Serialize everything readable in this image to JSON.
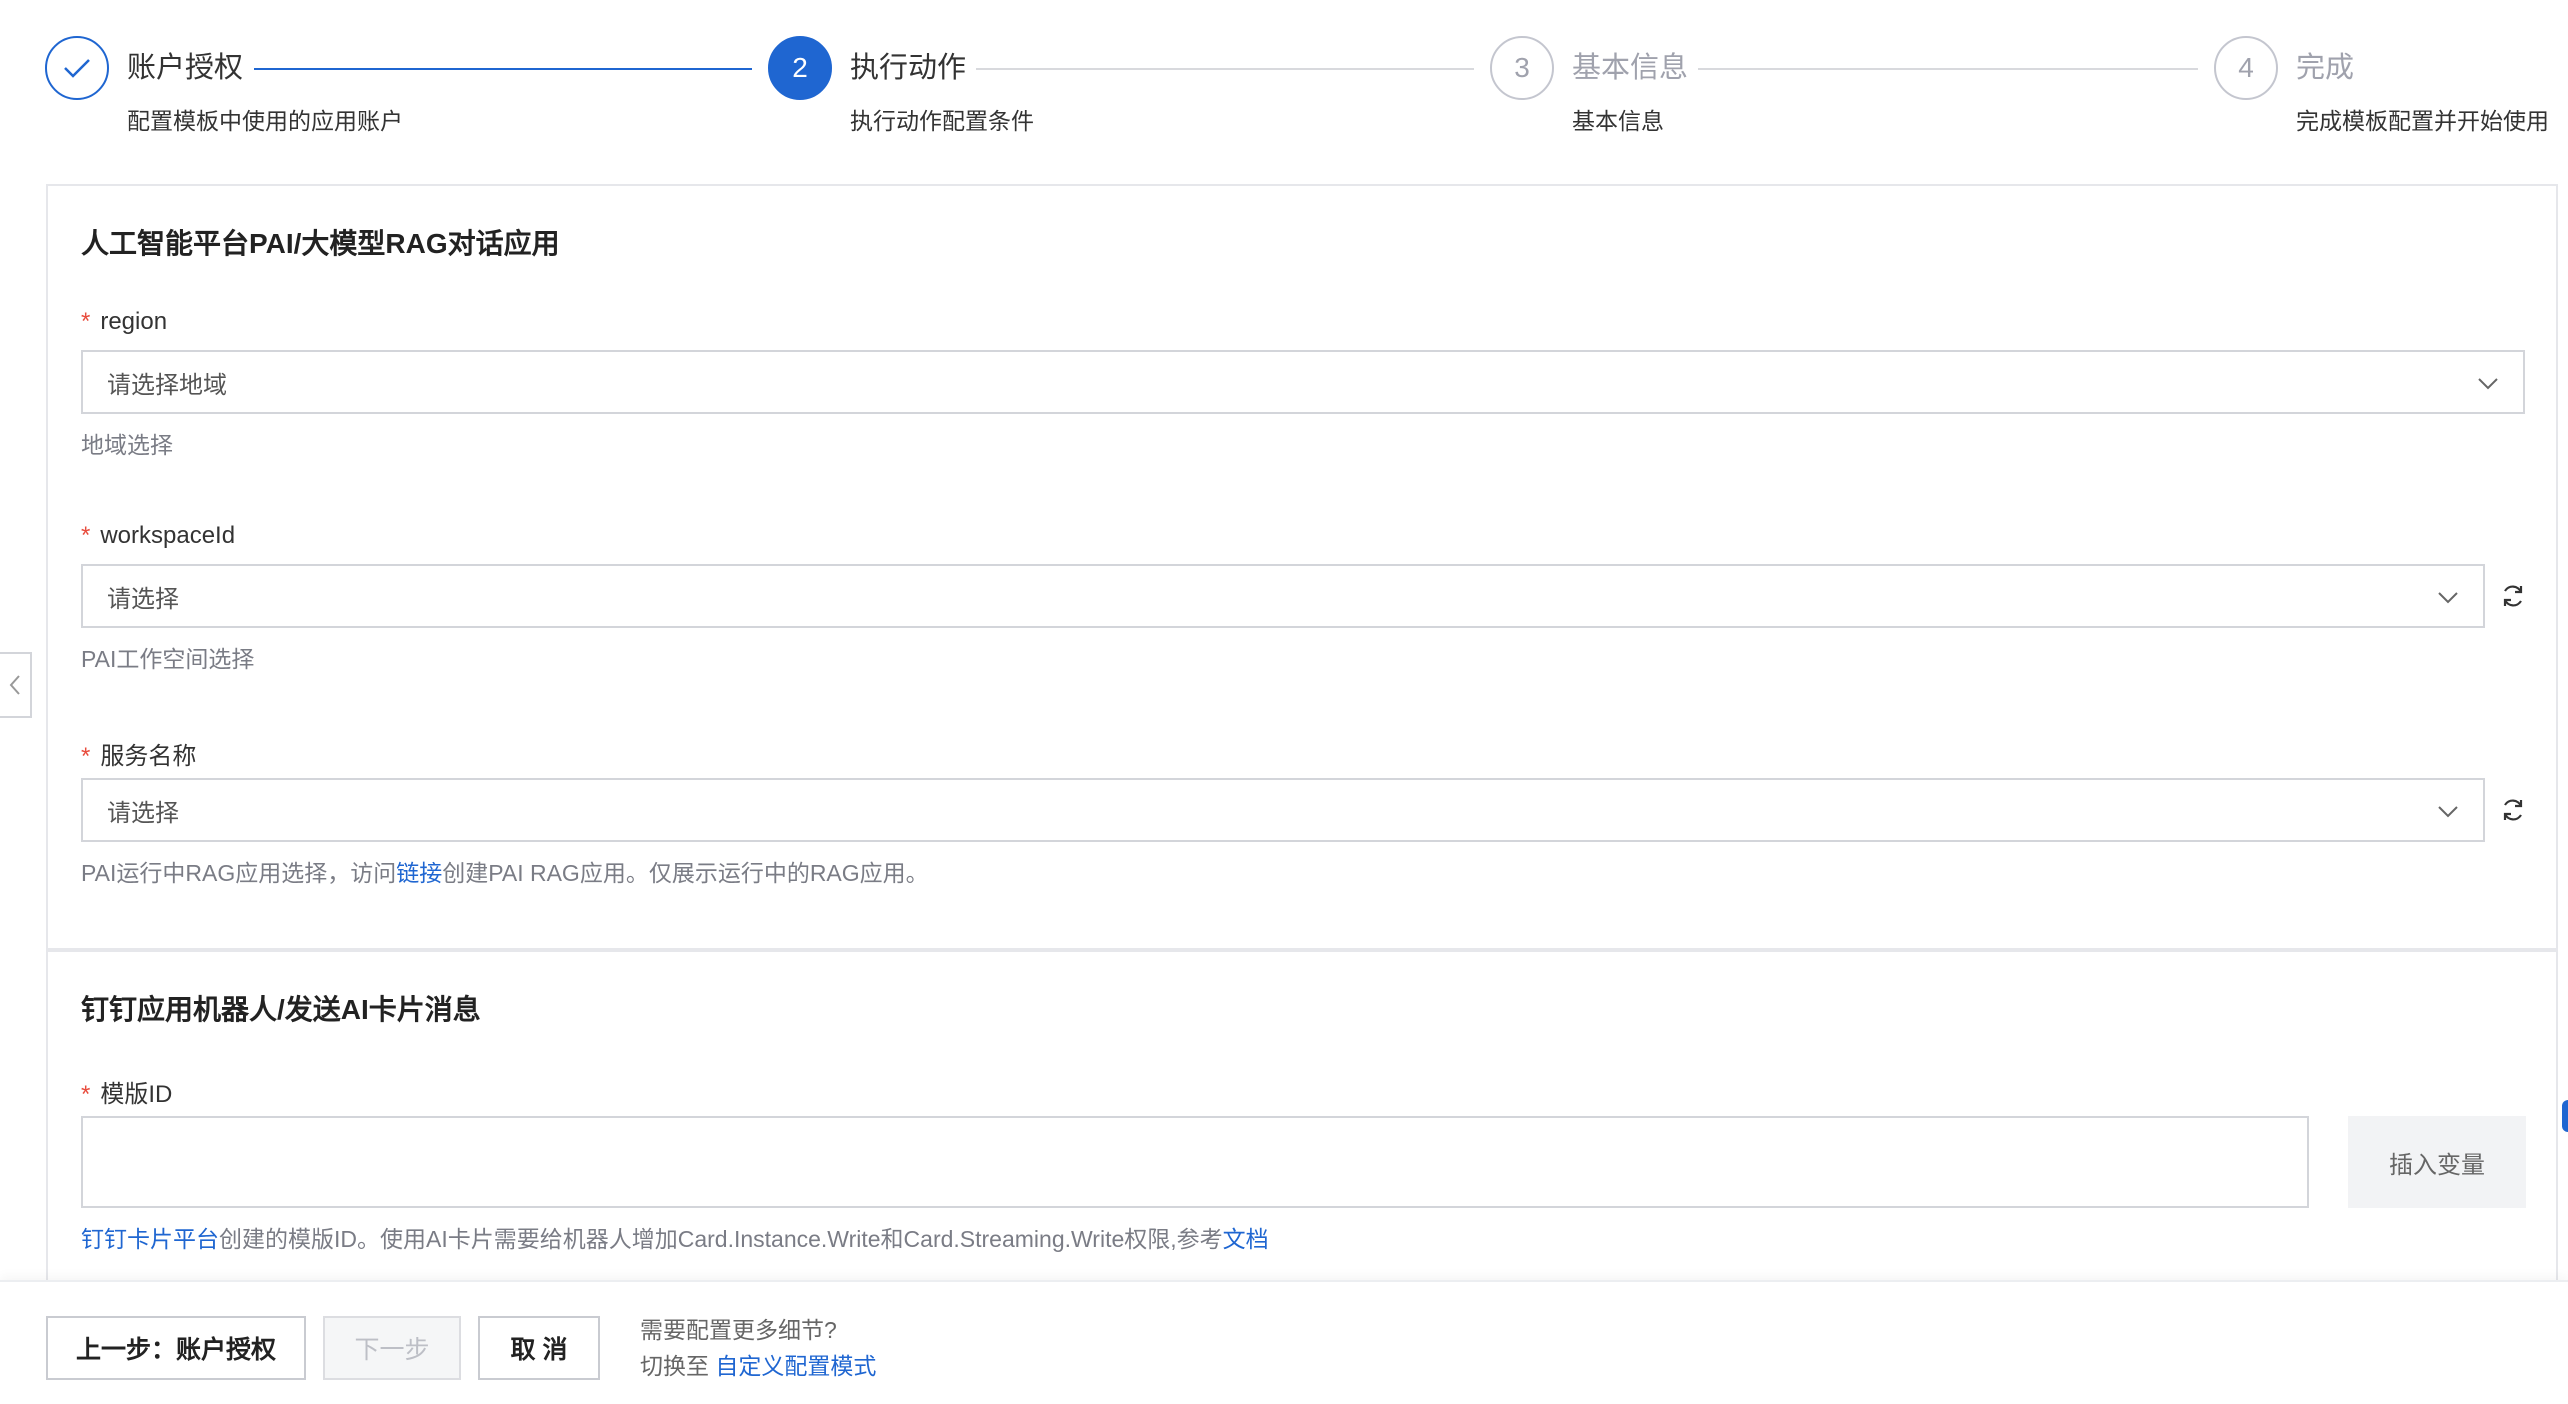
{
  "steps": [
    {
      "number": "1",
      "title": "账户授权",
      "desc": "配置模板中使用的应用账户",
      "state": "done"
    },
    {
      "number": "2",
      "title": "执行动作",
      "desc": "执行动作配置条件",
      "state": "active"
    },
    {
      "number": "3",
      "title": "基本信息",
      "desc": "基本信息",
      "state": "pending"
    },
    {
      "number": "4",
      "title": "完成",
      "desc": "完成模板配置并开始使用",
      "state": "pending"
    }
  ],
  "section1": {
    "title": "人工智能平台PAI/大模型RAG对话应用",
    "region": {
      "label": "region",
      "placeholder": "请选择地域",
      "help": "地域选择"
    },
    "workspace": {
      "label": "workspaceId",
      "placeholder": "请选择",
      "help": "PAI工作空间选择"
    },
    "service": {
      "label": "服务名称",
      "placeholder": "请选择",
      "help_before": "PAI运行中RAG应用选择，访问",
      "help_link": "链接",
      "help_after": "创建PAI RAG应用。仅展示运行中的RAG应用。"
    }
  },
  "section2": {
    "title": "钉钉应用机器人/发送AI卡片消息",
    "template": {
      "label": "模版ID",
      "insert_button": "插入变量",
      "help_link1": "钉钉卡片平台",
      "help_mid": "创建的模版ID。使用AI卡片需要给机器人增加Card.Instance.Write和Card.Streaming.Write权限,参考",
      "help_link2": "文档"
    }
  },
  "required_mark": "*",
  "footer": {
    "prev_button": "上一步：账户授权",
    "next_button": "下一步",
    "cancel_button": "取 消",
    "hint_line1": "需要配置更多细节?",
    "hint_line2_prefix": "切换至",
    "hint_link": "自定义配置模式"
  },
  "colors": {
    "accent": "#1f66d1",
    "required": "#e84c3d",
    "border": "#d3d5da"
  }
}
